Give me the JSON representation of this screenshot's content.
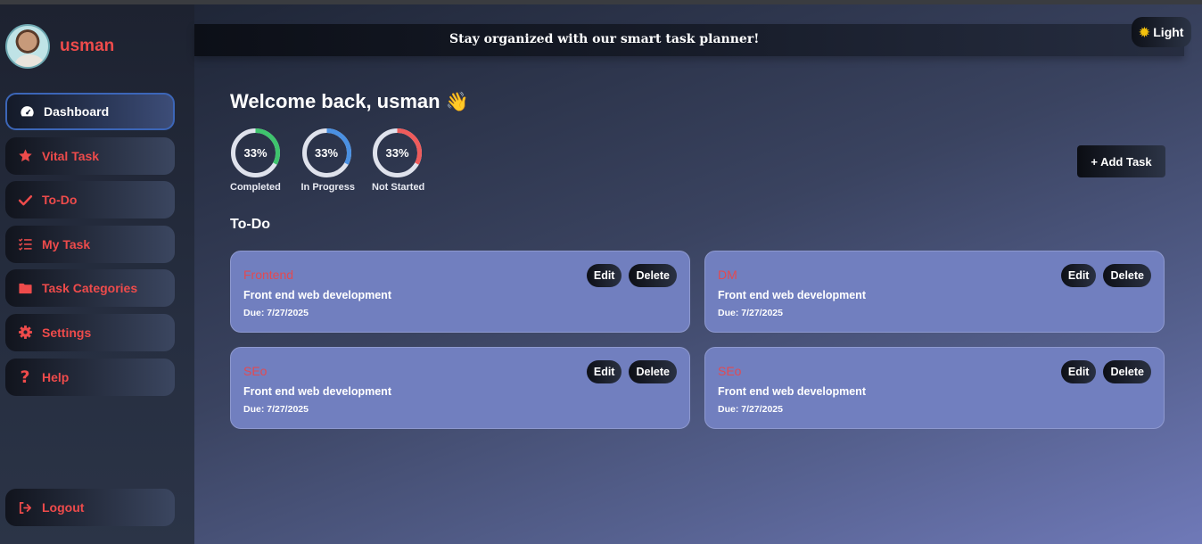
{
  "user": {
    "name": "usman"
  },
  "sidebar": {
    "items": [
      {
        "label": "Dashboard",
        "icon": "dashboard-icon",
        "active": true
      },
      {
        "label": "Vital Task",
        "icon": "star-icon"
      },
      {
        "label": "To-Do",
        "icon": "check-icon"
      },
      {
        "label": "My Task",
        "icon": "list-check-icon"
      },
      {
        "label": "Task Categories",
        "icon": "folder-icon"
      },
      {
        "label": "Settings",
        "icon": "gear-icon"
      },
      {
        "label": "Help",
        "icon": "question-icon"
      }
    ],
    "logout_label": "Logout"
  },
  "banner": {
    "text": "Stay organized with our smart task planner!"
  },
  "theme_toggle": {
    "label": "Light",
    "icon": "sun-icon"
  },
  "welcome": {
    "text": "Welcome back, usman",
    "emoji": "👋"
  },
  "stats": [
    {
      "value": "33%",
      "label": "Completed",
      "fraction": 0.33,
      "color": "#3ec46d"
    },
    {
      "value": "33%",
      "label": "In Progress",
      "fraction": 0.33,
      "color": "#4a90e2"
    },
    {
      "value": "33%",
      "label": "Not Started",
      "fraction": 0.33,
      "color": "#ef5b5b"
    }
  ],
  "add_task_label": "+ Add Task",
  "section_title": "To-Do",
  "tasks": [
    {
      "title": "Frontend",
      "description": "Front end web development",
      "due": "Due: 7/27/2025"
    },
    {
      "title": "DM",
      "description": "Front end web development",
      "due": "Due: 7/27/2025"
    },
    {
      "title": "SEo",
      "description": "Front end web development",
      "due": "Due: 7/27/2025"
    },
    {
      "title": "SEo",
      "description": "Front end web development",
      "due": "Due: 7/27/2025"
    }
  ],
  "card_actions": {
    "edit": "Edit",
    "delete": "Delete"
  },
  "colors": {
    "accent_red": "#ee4b4b",
    "card_bg": "#717fbf",
    "active_border": "#3c66b8"
  }
}
